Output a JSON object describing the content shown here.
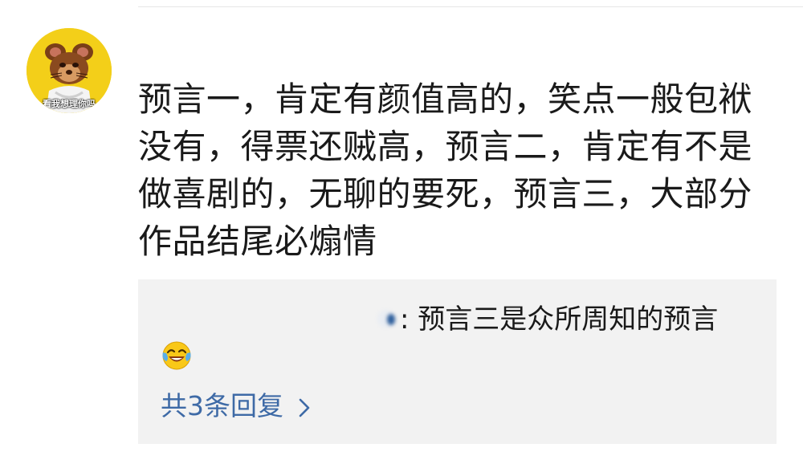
{
  "avatar": {
    "caption": "看我想理你吗"
  },
  "comment": {
    "text": "预言一，肯定有颜值高的，笑点一般包袱没有，得票还贼高，预言二，肯定有不是做喜剧的，无聊的要死，预言三，大部分作品结尾必煽情"
  },
  "reply": {
    "text": ": 预言三是众所周知的预言",
    "emoji": "crying-laughing-emoji",
    "count_label": "共3条回复"
  },
  "colors": {
    "link": "#3e6aa6",
    "reply_bg": "#f2f2f2",
    "text": "#1a1a1a"
  }
}
